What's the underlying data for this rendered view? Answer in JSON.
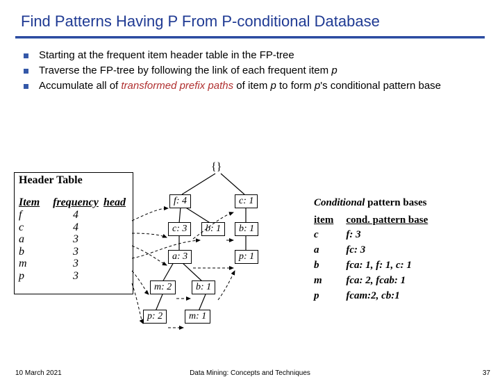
{
  "title": "Find Patterns Having P From P-conditional Database",
  "bullets": [
    {
      "text_a": "Starting at the frequent item header table in the FP-tree"
    },
    {
      "text_a": "Traverse the FP-tree by following the link of each frequent item ",
      "ital_b": "p"
    },
    {
      "text_a": "Accumulate all of ",
      "red_b": "transformed prefix paths",
      "text_c": " of item ",
      "ital_d": "p",
      "text_e": " to form ",
      "ital_f": "p",
      "text_g": "'s conditional pattern base"
    }
  ],
  "header_table": {
    "title": "Header Table",
    "cols": [
      "Item",
      "frequency",
      "head"
    ],
    "rows": [
      {
        "item": "f",
        "freq": "4"
      },
      {
        "item": "c",
        "freq": "4"
      },
      {
        "item": "a",
        "freq": "3"
      },
      {
        "item": "b",
        "freq": "3"
      },
      {
        "item": "m",
        "freq": "3"
      },
      {
        "item": "p",
        "freq": "3"
      }
    ]
  },
  "tree": {
    "root": "{}",
    "nodes": {
      "f4": "f: 4",
      "c1": "c: 1",
      "c3": "c: 3",
      "b1a": "b: 1",
      "b1b": "b: 1",
      "a3": "a: 3",
      "p1": "p: 1",
      "m2": "m: 2",
      "b1c": "b: 1",
      "p2": "p: 2",
      "m1": "m: 1"
    }
  },
  "cond": {
    "title_bold": "Conditional",
    "title_rest": " pattern bases",
    "cols": [
      "item",
      "cond. pattern base"
    ],
    "rows": [
      {
        "item": "c",
        "base": "f: 3"
      },
      {
        "item": "a",
        "base": "fc: 3"
      },
      {
        "item": "b",
        "base": "fca: 1, f: 1, c: 1"
      },
      {
        "item": "m",
        "base": "fca: 2, fcab: 1"
      },
      {
        "item": "p",
        "base": "fcam:2, cb:1"
      }
    ]
  },
  "footer": {
    "date": "10 March 2021",
    "mid": "Data Mining: Concepts and Techniques",
    "num": "37"
  }
}
